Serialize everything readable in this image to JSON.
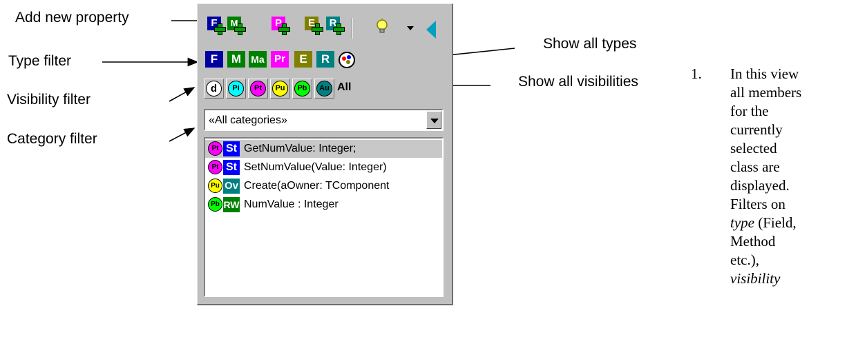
{
  "callouts": {
    "add_new_property": "Add new property",
    "type_filter": "Type filter",
    "visibility_filter": "Visibility filter",
    "category_filter": "Category filter",
    "show_all_types": "Show all types",
    "show_all_visibilities": "Show all visibilities"
  },
  "toolbar": {
    "add_buttons": [
      {
        "letter": "F",
        "color": "#0000a0",
        "icon": "add-field-icon"
      },
      {
        "letter": "M",
        "color": "#008000",
        "icon": "add-method-icon"
      },
      {
        "letter": "P",
        "color": "#ff00ff",
        "icon": "add-property-icon"
      },
      {
        "letter": "E",
        "color": "#808000",
        "icon": "add-event-icon"
      },
      {
        "letter": "R",
        "color": "#008080",
        "icon": "add-resource-icon"
      }
    ],
    "extra_icons": [
      "lightbulb-icon",
      "dropdown-arrow-icon",
      "collapse-triangle-icon"
    ]
  },
  "type_filter": {
    "items": [
      {
        "label": "F",
        "color": "#0000a0"
      },
      {
        "label": "M",
        "color": "#008000"
      },
      {
        "label": "Ma",
        "color": "#008000"
      },
      {
        "label": "Pr",
        "color": "#ff00ff"
      },
      {
        "label": "E",
        "color": "#808000"
      },
      {
        "label": "R",
        "color": "#008080"
      }
    ],
    "show_all_icon": "show-all-types-icon"
  },
  "visibility_filter": {
    "items": [
      {
        "label": "d",
        "color": "#ffffff"
      },
      {
        "label": "Pi",
        "color": "#00ffff"
      },
      {
        "label": "Pt",
        "color": "#ff00ff"
      },
      {
        "label": "Pu",
        "color": "#ffff00"
      },
      {
        "label": "Pb",
        "color": "#00ff00"
      },
      {
        "label": "Au",
        "color": "#008080"
      }
    ],
    "all_label": "All"
  },
  "category_filter": {
    "selected": "«All categories»"
  },
  "members": [
    {
      "vis": "Pt",
      "vis_color": "#ff00ff",
      "kind": "St",
      "kind_color": "#0000ff",
      "text": "GetNumValue: Integer;",
      "selected": true
    },
    {
      "vis": "Pt",
      "vis_color": "#ff00ff",
      "kind": "St",
      "kind_color": "#0000ff",
      "text": "SetNumValue(Value: Integer)",
      "selected": false
    },
    {
      "vis": "Pu",
      "vis_color": "#ffff00",
      "kind": "Ov",
      "kind_color": "#008080",
      "text": "Create(aOwner: TComponent",
      "selected": false
    },
    {
      "vis": "Pb",
      "vis_color": "#00ff00",
      "kind": "RW",
      "kind_color": "#008000",
      "text": "NumValue : Integer",
      "selected": false
    }
  ],
  "note": {
    "number": "1.",
    "lines": [
      "In this view",
      "all members",
      "for the",
      "currently",
      "selected",
      "class are",
      "displayed.",
      "Filters on",
      "type (Field,",
      "Method",
      "etc.),",
      "visibility"
    ]
  }
}
